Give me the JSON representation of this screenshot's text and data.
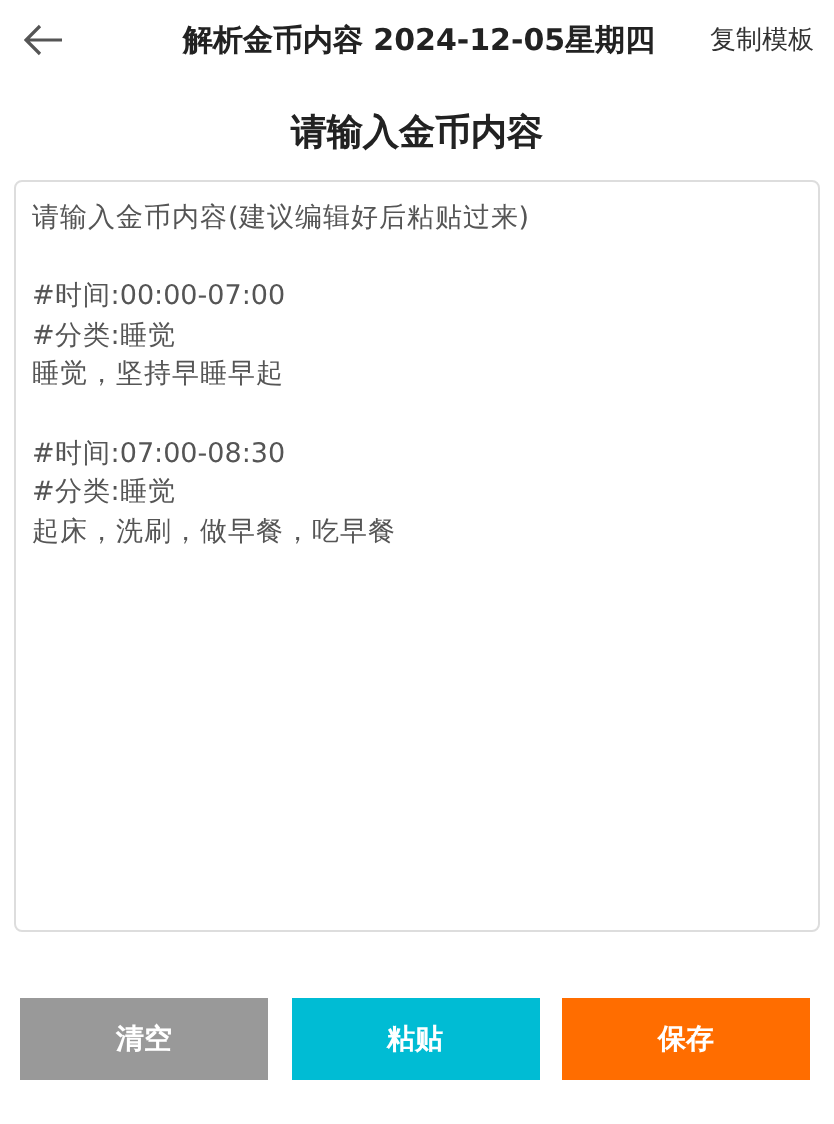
{
  "header": {
    "title": "解析金币内容 2024-12-05星期四",
    "action": "复制模板"
  },
  "heading": "请输入金币内容",
  "content_field": {
    "paragraphs": [
      [
        "请输入金币内容(建议编辑好后粘贴过来)"
      ],
      [
        "#时间:00:00-07:00",
        "#分类:睡觉",
        "睡觉，坚持早睡早起"
      ],
      [
        "#时间:07:00-08:30",
        "#分类:睡觉",
        "起床，洗刷，做早餐，吃早餐"
      ]
    ]
  },
  "buttons": [
    {
      "label": "清空",
      "color": "#999999"
    },
    {
      "label": "粘贴",
      "color": "#00bcd4"
    },
    {
      "label": "保存",
      "color": "#ff6d00"
    }
  ]
}
